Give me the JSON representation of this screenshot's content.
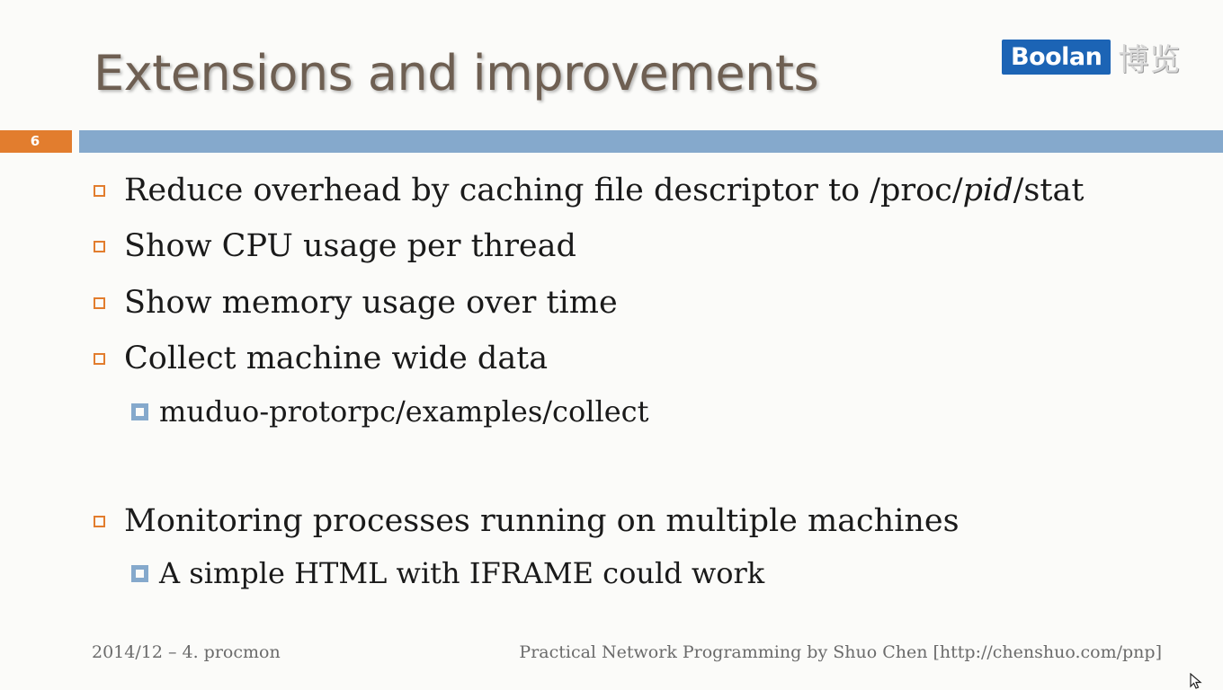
{
  "slide": {
    "title": "Extensions and improvements",
    "number": "6",
    "logo": {
      "brand": "Boolan",
      "chinese": "博览"
    },
    "bullets": [
      {
        "level": 1,
        "parts": [
          "Reduce overhead by caching file descriptor to /proc/",
          "pid",
          "/stat"
        ]
      },
      {
        "level": 1,
        "text": "Show CPU usage per thread"
      },
      {
        "level": 1,
        "text": "Show memory usage over time"
      },
      {
        "level": 1,
        "text": "Collect machine wide data"
      },
      {
        "level": 2,
        "text": "muduo-protorpc/examples/collect"
      },
      {
        "level": 1,
        "text": "Monitoring processes running on multiple machines"
      },
      {
        "level": 2,
        "text": "A simple HTML with IFRAME could work"
      }
    ],
    "footer_left": "2014/12 – 4. procmon",
    "footer_right": "Practical Network Programming by Shuo Chen [http://chenshuo.com/pnp]"
  },
  "colors": {
    "title": "#6e5f52",
    "accent_orange": "#e27d2e",
    "accent_blue": "#85a9cc",
    "logo_blue": "#1c64b5",
    "background": "#fbfbf9"
  },
  "icons": [
    "checkbox-bullet-icon",
    "square-bullet-icon",
    "mouse-pointer-icon"
  ]
}
